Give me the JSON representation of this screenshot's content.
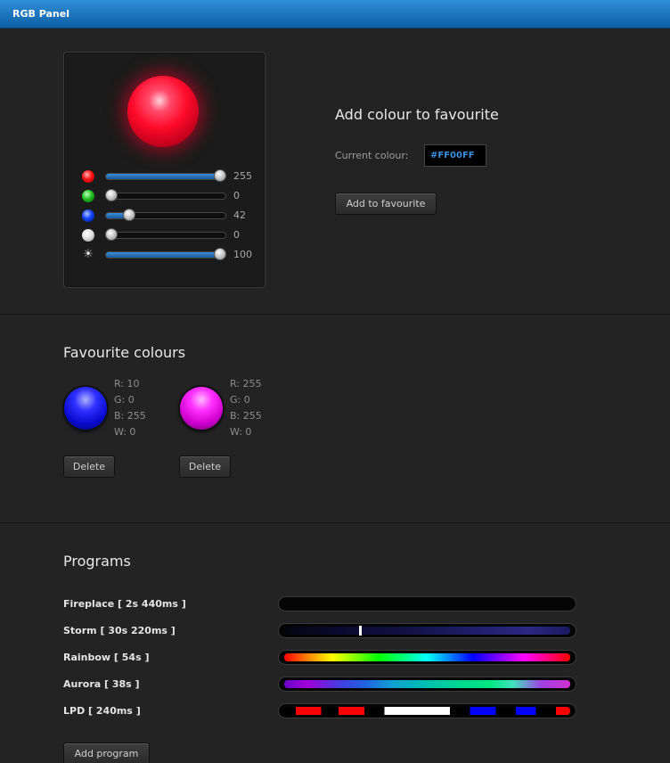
{
  "window": {
    "title": "RGB Panel"
  },
  "picker": {
    "sliders": [
      {
        "name": "red",
        "value": "255",
        "level": 1.0
      },
      {
        "name": "green",
        "value": "0",
        "level": 0.0
      },
      {
        "name": "blue",
        "value": "42",
        "level": 0.165
      },
      {
        "name": "white",
        "value": "0",
        "level": 0.0
      },
      {
        "name": "brightness",
        "value": "100",
        "level": 1.0
      }
    ],
    "brightness_icon": "☀"
  },
  "add_favourite": {
    "heading": "Add colour to favourite",
    "current_label": "Current colour:",
    "current_value": "#FF00FF",
    "button": "Add to favourite"
  },
  "favourites": {
    "heading": "Favourite colours",
    "items": [
      {
        "color": "#0a0aff",
        "r": "R: 10",
        "g": "G: 0",
        "b": "B: 255",
        "w": "W: 0",
        "delete": "Delete"
      },
      {
        "color": "#ff00ff",
        "r": "R: 255",
        "g": "G: 0",
        "b": "B: 255",
        "w": "W: 0",
        "delete": "Delete"
      }
    ]
  },
  "programs": {
    "heading": "Programs",
    "items": [
      {
        "label": "Fireplace [ 2s 440ms ]"
      },
      {
        "label": "Storm [ 30s 220ms ]"
      },
      {
        "label": "Rainbow [ 54s ]"
      },
      {
        "label": "Aurora [ 38s ]"
      },
      {
        "label": "LPD [ 240ms ]"
      }
    ],
    "add_button": "Add program"
  }
}
